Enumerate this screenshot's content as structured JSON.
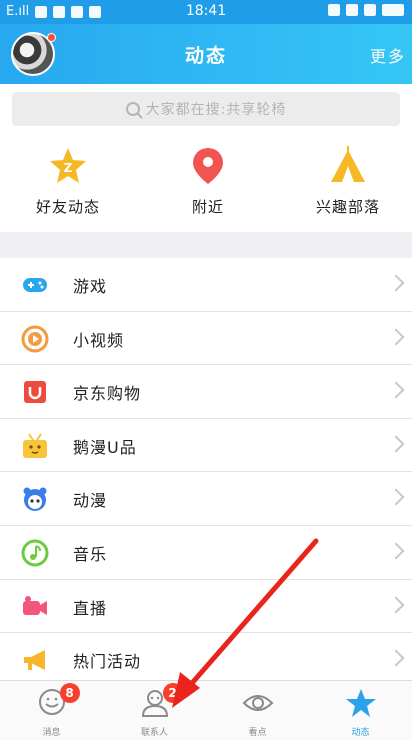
{
  "statusbar": {
    "carrier": "E.ıll",
    "time": "18:41"
  },
  "header": {
    "title": "动态",
    "more": "更多",
    "avatar_has_notification": true
  },
  "search": {
    "placeholder": "大家都在搜:共享轮椅"
  },
  "quick_items": [
    {
      "label": "好友动态",
      "icon": "friends-feed-star-icon",
      "color": "#f6b825"
    },
    {
      "label": "附近",
      "icon": "location-pin-icon",
      "color": "#f2554f"
    },
    {
      "label": "兴趣部落",
      "icon": "tribe-tent-icon",
      "color": "#f6b825"
    }
  ],
  "list_items": [
    {
      "label": "游戏",
      "icon": "gamepad-icon",
      "color": "#2aa6ee"
    },
    {
      "label": "小视频",
      "icon": "play-circle-icon",
      "color": "#f59a3e"
    },
    {
      "label": "京东购物",
      "icon": "shopping-bag-icon",
      "color": "#ec4c3f"
    },
    {
      "label": "鹅漫U品",
      "icon": "gift-box-icon",
      "color": "#f7c43a"
    },
    {
      "label": "动漫",
      "icon": "anime-character-icon",
      "color": "#3b7ee8"
    },
    {
      "label": "音乐",
      "icon": "music-note-icon",
      "color": "#6ccb3e"
    },
    {
      "label": "直播",
      "icon": "video-camera-icon",
      "color": "#f2567a"
    },
    {
      "label": "热门活动",
      "icon": "megaphone-icon",
      "color": "#f6b52a"
    }
  ],
  "tabs": [
    {
      "label": "消息",
      "icon": "message-bubble-icon",
      "badge": "8",
      "active": false
    },
    {
      "label": "联系人",
      "icon": "contacts-person-icon",
      "badge": "2",
      "active": false
    },
    {
      "label": "看点",
      "icon": "eye-icon",
      "badge": "",
      "active": false
    },
    {
      "label": "动态",
      "icon": "star-icon",
      "badge": "",
      "active": true
    }
  ],
  "annotation": {
    "color": "#e8241c"
  }
}
